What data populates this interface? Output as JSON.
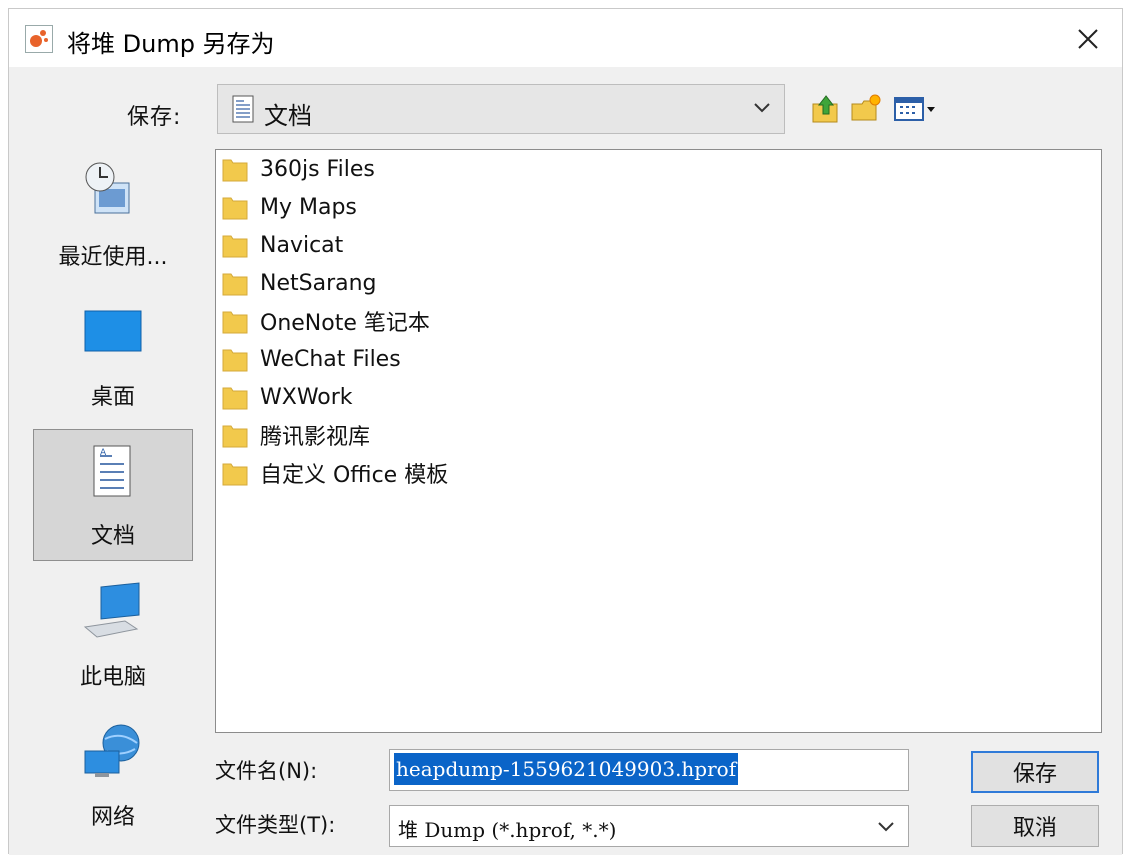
{
  "window": {
    "title": "将堆 Dump 另存为",
    "icon": "java-app-icon"
  },
  "save_in": {
    "label": "保存:",
    "value": "文档",
    "icon": "document-folder-icon"
  },
  "toolbar": {
    "up_icon": "up-one-level-icon",
    "new_folder_icon": "new-folder-icon",
    "view_icon": "view-menu-icon"
  },
  "places": [
    {
      "label": "最近使用...",
      "icon": "recent-icon"
    },
    {
      "label": "桌面",
      "icon": "desktop-icon"
    },
    {
      "label": "文档",
      "icon": "documents-icon",
      "selected": true
    },
    {
      "label": "此电脑",
      "icon": "computer-icon"
    },
    {
      "label": "网络",
      "icon": "network-icon"
    }
  ],
  "files": [
    {
      "name": "360js Files"
    },
    {
      "name": "My Maps"
    },
    {
      "name": "Navicat"
    },
    {
      "name": "NetSarang"
    },
    {
      "name": "OneNote 笔记本"
    },
    {
      "name": "WeChat Files"
    },
    {
      "name": "WXWork"
    },
    {
      "name": "腾讯影视库"
    },
    {
      "name": "自定义 Office 模板"
    }
  ],
  "filename": {
    "label": "文件名(N):",
    "value": "heapdump-1559621049903.hprof"
  },
  "filetype": {
    "label": "文件类型(T):",
    "value": "堆 Dump (*.hprof, *.*)"
  },
  "buttons": {
    "save": "保存",
    "cancel": "取消"
  },
  "colors": {
    "selection": "#0a64c8",
    "folder": "#f2c94c",
    "default_button_border": "#2f7ad8"
  }
}
